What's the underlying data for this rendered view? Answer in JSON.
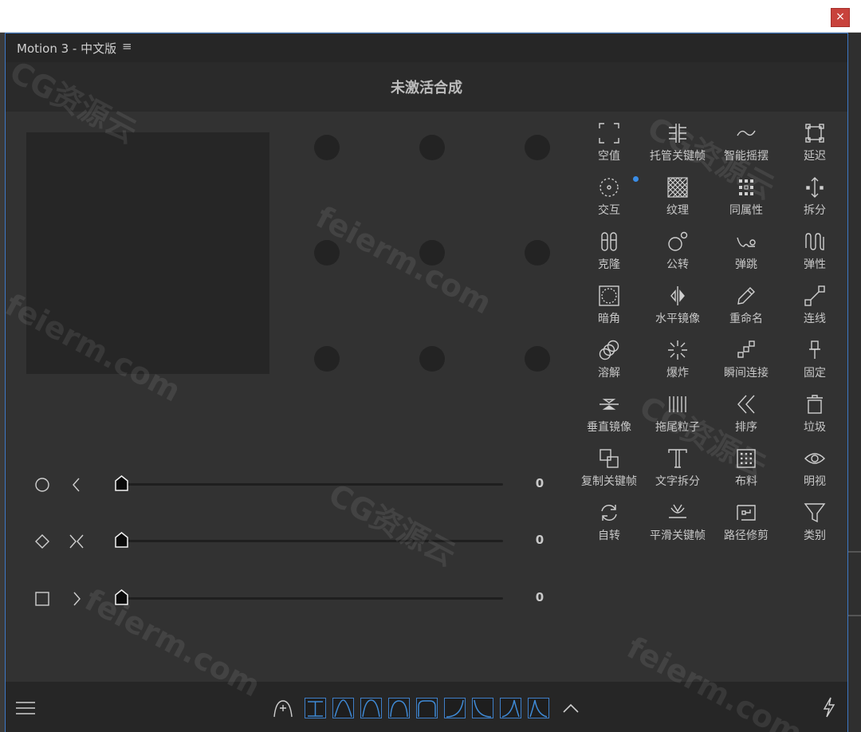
{
  "window": {
    "close_label": "×"
  },
  "panel": {
    "title": "Motion 3 - 中文版",
    "menu_icon": "hamburger-menu-icon"
  },
  "composition": {
    "name": "未激活合成"
  },
  "sliders": [
    {
      "shape_icon": "circle-icon",
      "dir_icon": "chevron-left-icon",
      "value": "0",
      "position": 0
    },
    {
      "shape_icon": "diamond-icon",
      "dir_icon": "arrows-inward-icon",
      "value": "0",
      "position": 0
    },
    {
      "shape_icon": "square-icon",
      "dir_icon": "chevron-right-icon",
      "value": "0",
      "position": 0
    }
  ],
  "tools": [
    {
      "label": "空值",
      "icon": "null-frame-icon"
    },
    {
      "label": "托管关键帧",
      "icon": "keyframe-bars-icon"
    },
    {
      "label": "智能摇摆",
      "icon": "wave-icon"
    },
    {
      "label": "延迟",
      "icon": "delay-square-icon"
    },
    {
      "label": "交互",
      "icon": "dashed-circle-icon"
    },
    {
      "label": "纹理",
      "icon": "texture-grid-icon"
    },
    {
      "label": "同属性",
      "icon": "dot-grid-icon"
    },
    {
      "label": "拆分",
      "icon": "split-arrows-icon"
    },
    {
      "label": "克隆",
      "icon": "clone-capsules-icon"
    },
    {
      "label": "公转",
      "icon": "orbit-icon"
    },
    {
      "label": "弹跳",
      "icon": "bounce-icon"
    },
    {
      "label": "弹性",
      "icon": "elastic-icon"
    },
    {
      "label": "暗角",
      "icon": "vignette-icon"
    },
    {
      "label": "水平镜像",
      "icon": "mirror-horizontal-icon"
    },
    {
      "label": "重命名",
      "icon": "pencil-icon"
    },
    {
      "label": "连线",
      "icon": "connect-line-icon"
    },
    {
      "label": "溶解",
      "icon": "dissolve-circles-icon"
    },
    {
      "label": "爆炸",
      "icon": "explode-icon"
    },
    {
      "label": "瞬间连接",
      "icon": "instant-link-icon"
    },
    {
      "label": "固定",
      "icon": "pin-icon"
    },
    {
      "label": "垂直镜像",
      "icon": "mirror-vertical-icon"
    },
    {
      "label": "拖尾粒子",
      "icon": "trail-particles-icon"
    },
    {
      "label": "排序",
      "icon": "double-chevron-left-icon"
    },
    {
      "label": "垃圾",
      "icon": "trash-icon"
    },
    {
      "label": "复制关键帧",
      "icon": "copy-icon"
    },
    {
      "label": "文字拆分",
      "icon": "text-t-icon"
    },
    {
      "label": "布料",
      "icon": "cloth-grid-icon"
    },
    {
      "label": "明视",
      "icon": "eye-icon"
    },
    {
      "label": "自转",
      "icon": "rotate-icon"
    },
    {
      "label": "平滑关键帧",
      "icon": "smooth-keyframe-icon"
    },
    {
      "label": "路径修剪",
      "icon": "path-trim-icon"
    },
    {
      "label": "类别",
      "icon": "filter-funnel-icon"
    }
  ],
  "bottom_bar": {
    "menu_icon": "hamburger-icon",
    "curve_add_icon": "curve-add-icon",
    "ease_presets": [
      "ease-linear-icon",
      "ease-in-out-icon",
      "ease-in-out-2-icon",
      "ease-in-out-3-icon",
      "ease-in-out-4-icon",
      "ease-in-icon",
      "ease-out-icon",
      "ease-overshoot-in-icon",
      "ease-overshoot-out-icon"
    ],
    "collapse_icon": "chevron-up-icon",
    "lightning_icon": "lightning-icon"
  },
  "watermarks": [
    "CG资源云",
    "feierm.com",
    "CG资源云",
    "feierm.com",
    "CG资源云",
    "feierm.com",
    "CG资源云",
    "feierm.com"
  ],
  "colors": {
    "accent": "#3d79c7",
    "close": "#c8423c",
    "panel_bg": "#323232"
  }
}
